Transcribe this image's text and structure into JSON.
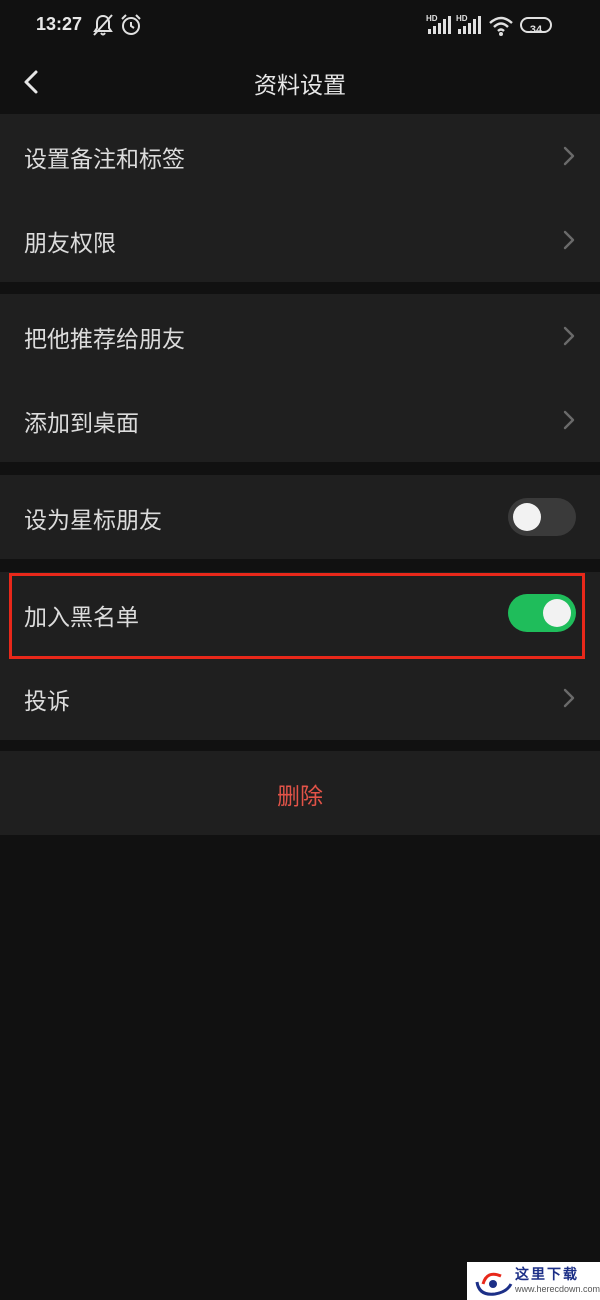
{
  "status_bar": {
    "time": "13:27",
    "battery": "34",
    "signal_label_1": "HD",
    "signal_label_2": "HD"
  },
  "nav": {
    "title": "资料设置",
    "back_icon": "chevron-left-icon"
  },
  "groups": [
    {
      "items": [
        {
          "label": "设置备注和标签",
          "type": "chevron"
        },
        {
          "label": "朋友权限",
          "type": "chevron"
        }
      ]
    },
    {
      "items": [
        {
          "label": "把他推荐给朋友",
          "type": "chevron"
        },
        {
          "label": "添加到桌面",
          "type": "chevron"
        }
      ]
    },
    {
      "items": [
        {
          "label": "设为星标朋友",
          "type": "toggle",
          "on": false
        }
      ]
    },
    {
      "items": [
        {
          "label": "加入黑名单",
          "type": "toggle",
          "on": true,
          "highlighted": true
        },
        {
          "label": "投诉",
          "type": "chevron"
        }
      ]
    }
  ],
  "delete_label": "删除",
  "colors": {
    "background": "#111111",
    "surface": "#1f1f1f",
    "toggle_on": "#1fbd5b",
    "toggle_off": "#3a3a3a",
    "delete": "#e25348",
    "highlight": "#e8281a"
  },
  "watermark": {
    "title": "这里下载",
    "url": "www.herecdown.com"
  }
}
